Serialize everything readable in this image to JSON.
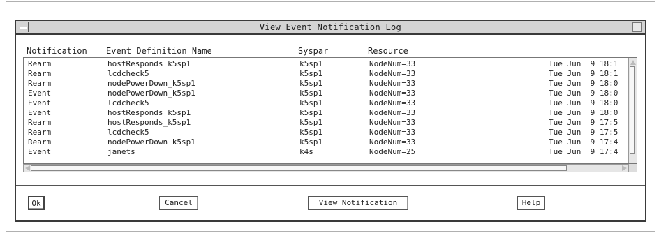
{
  "window": {
    "title": "View Event Notification Log"
  },
  "columns": {
    "notification": "Notification",
    "event_definition": "Event Definition Name",
    "syspar": "Syspar",
    "resource": "Resource"
  },
  "rows": [
    {
      "notification": "Rearm",
      "definition": "hostResponds_k5sp1",
      "syspar": "k5sp1",
      "resource": "NodeNum=33",
      "date": "Tue Jun  9 18:1"
    },
    {
      "notification": "Rearm",
      "definition": "lcdcheck5",
      "syspar": "k5sp1",
      "resource": "NodeNum=33",
      "date": "Tue Jun  9 18:1"
    },
    {
      "notification": "Rearm",
      "definition": "nodePowerDown_k5sp1",
      "syspar": "k5sp1",
      "resource": "NodeNum=33",
      "date": "Tue Jun  9 18:0"
    },
    {
      "notification": "Event",
      "definition": "nodePowerDown_k5sp1",
      "syspar": "k5sp1",
      "resource": "NodeNum=33",
      "date": "Tue Jun  9 18:0"
    },
    {
      "notification": "Event",
      "definition": "lcdcheck5",
      "syspar": "k5sp1",
      "resource": "NodeNum=33",
      "date": "Tue Jun  9 18:0"
    },
    {
      "notification": "Event",
      "definition": "hostResponds_k5sp1",
      "syspar": "k5sp1",
      "resource": "NodeNum=33",
      "date": "Tue Jun  9 18:0"
    },
    {
      "notification": "Rearm",
      "definition": "hostResponds_k5sp1",
      "syspar": "k5sp1",
      "resource": "NodeNum=33",
      "date": "Tue Jun  9 17:5"
    },
    {
      "notification": "Rearm",
      "definition": "lcdcheck5",
      "syspar": "k5sp1",
      "resource": "NodeNum=33",
      "date": "Tue Jun  9 17:5"
    },
    {
      "notification": "Rearm",
      "definition": "nodePowerDown_k5sp1",
      "syspar": "k5sp1",
      "resource": "NodeNum=33",
      "date": "Tue Jun  9 17:4"
    },
    {
      "notification": "Event",
      "definition": "janets",
      "syspar": "k4s",
      "resource": "NodeNum=25",
      "date": "Tue Jun  9 17:4"
    }
  ],
  "buttons": {
    "ok": "Ok",
    "cancel": "Cancel",
    "view_notification": "View Notification",
    "help": "Help"
  }
}
